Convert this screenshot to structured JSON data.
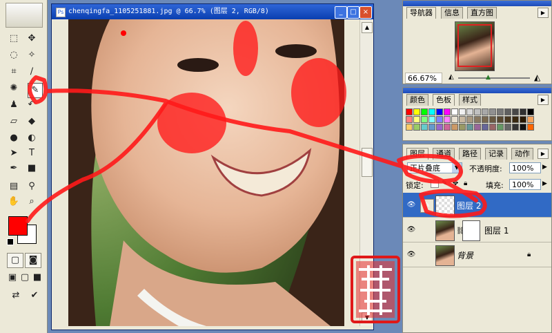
{
  "document": {
    "title": "chenqingfa_1105251881.jpg @ 66.7% (图层 2, RGB/8)"
  },
  "navigator": {
    "tabs": [
      "导航器",
      "信息",
      "直方图"
    ],
    "zoom": "66.67%"
  },
  "colors_panel": {
    "tabs": [
      "颜色",
      "色板",
      "样式"
    ],
    "swatches": [
      "#ff0000",
      "#ffff00",
      "#00ff00",
      "#00ffff",
      "#0000ff",
      "#ff00ff",
      "#ffffff",
      "#f0f0f0",
      "#d8d8d8",
      "#c0c0c0",
      "#a8a8a8",
      "#909090",
      "#787878",
      "#606060",
      "#484848",
      "#303030",
      "#000000",
      "#ff8080",
      "#ffff80",
      "#80ff80",
      "#80ffff",
      "#8080ff",
      "#ff80ff",
      "#e8e0d0",
      "#c8b8a0",
      "#a89880",
      "#887860",
      "#786850",
      "#685840",
      "#584830",
      "#483820",
      "#382810",
      "#281800",
      "#f4a460",
      "#ffcc66",
      "#99cc66",
      "#66cccc",
      "#6699cc",
      "#9966cc",
      "#cc6699",
      "#cc9966",
      "#999966",
      "#669999",
      "#996699",
      "#666699",
      "#996666",
      "#669966",
      "#666666",
      "#333333",
      "#111111",
      "#ff6600"
    ]
  },
  "layers_panel": {
    "tabs": [
      "图层",
      "通道",
      "路径",
      "记录",
      "动作"
    ],
    "blend_mode": "正片叠底",
    "opacity_label": "不透明度:",
    "opacity_value": "100%",
    "lock_label": "锁定:",
    "fill_label": "填充:",
    "fill_value": "100%",
    "layers": [
      {
        "name": "图层 2",
        "selected": true
      },
      {
        "name": "图层 1",
        "selected": false
      },
      {
        "name": "背景",
        "selected": false,
        "locked": true
      }
    ]
  },
  "toolbox": {
    "foreground_color": "#ff0000",
    "background_color": "#ffffff"
  },
  "seal_text": "陈庆发"
}
